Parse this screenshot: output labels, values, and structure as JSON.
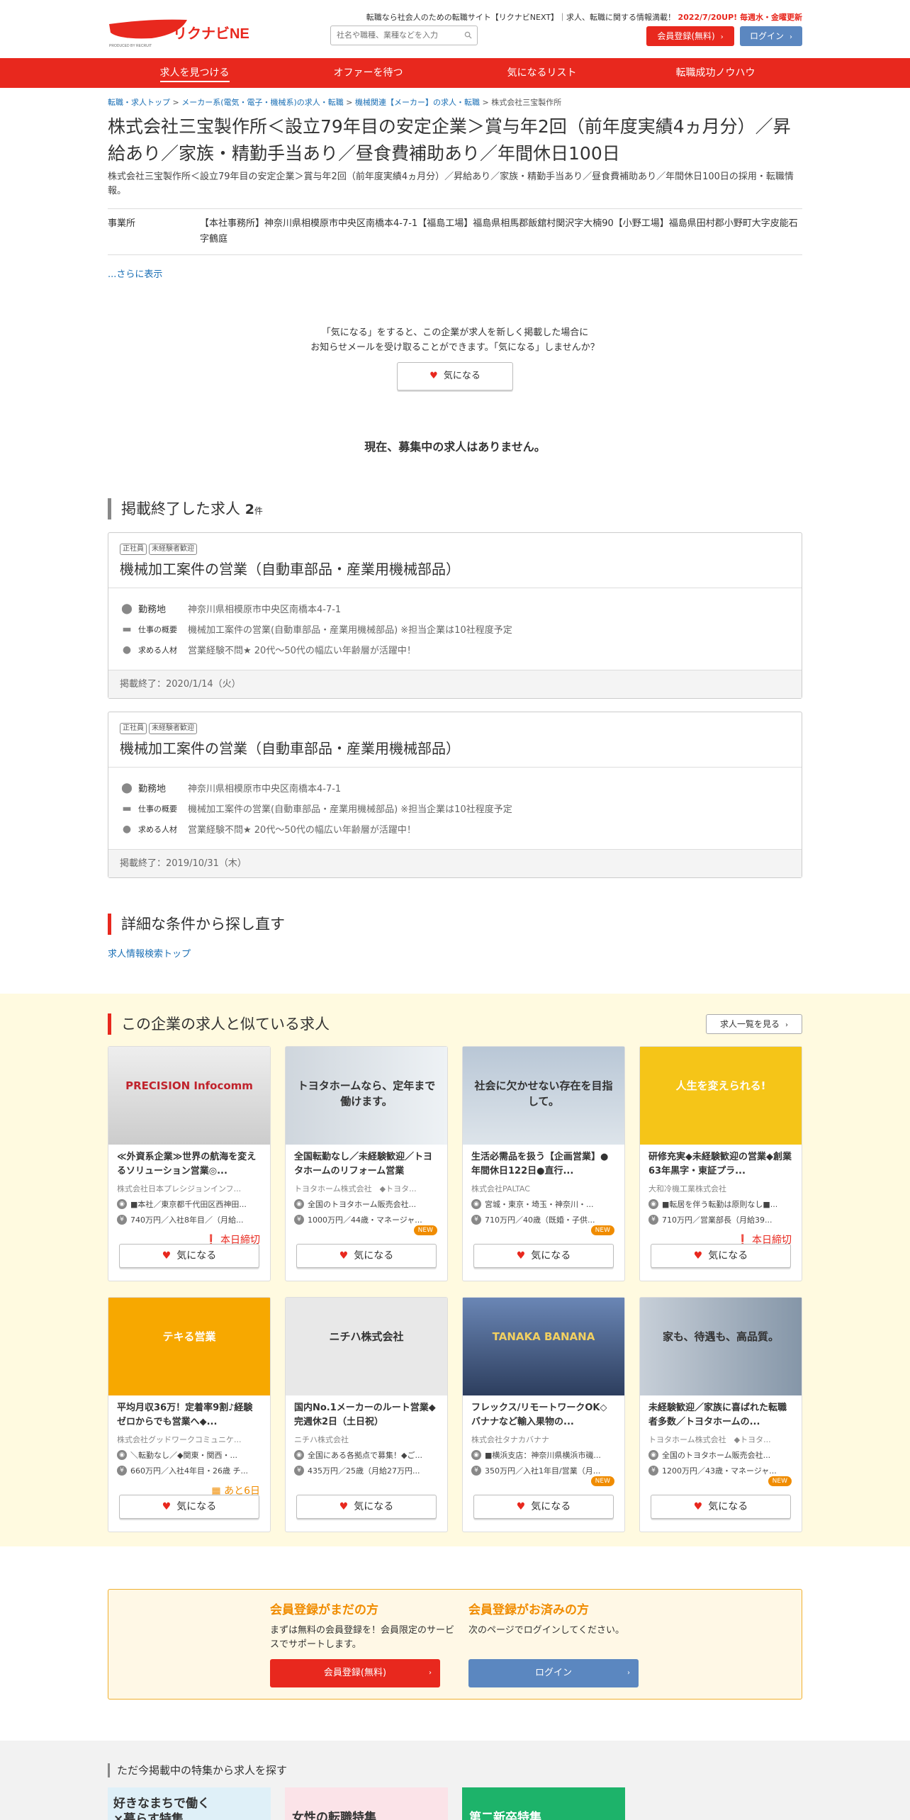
{
  "header": {
    "logo_text": "リクナビNEXT",
    "logo_sub": "PRODUCED BY RECRUIT",
    "tagline": "転職なら社会人のための転職サイト【リクナビNEXT】｜求人、転職に関する情報満載！",
    "tagline_highlight": "2022/7/20UP! 毎週水・金曜更新",
    "search_placeholder": "社名や職種、業種などを入力",
    "register_label": "会員登録(無料)",
    "login_label": "ログイン"
  },
  "nav": [
    {
      "label": "求人を見つける",
      "active": true
    },
    {
      "label": "オファーを待つ",
      "active": false
    },
    {
      "label": "気になるリスト",
      "active": false
    },
    {
      "label": "転職成功ノウハウ",
      "active": false
    }
  ],
  "breadcrumb": {
    "items": [
      "転職・求人トップ",
      "メーカー系(電気・電子・機械系)の求人・転職",
      "機械関連【メーカー】の求人・転職"
    ],
    "current": "株式会社三宝製作所"
  },
  "company": {
    "title": "株式会社三宝製作所＜設立79年目の安定企業＞賞与年2回（前年度実績4ヵ月分）／昇給あり／家族・精勤手当あり／昼食費補助あり／年間休日100日",
    "subtitle": "株式会社三宝製作所＜設立79年目の安定企業＞賞与年2回（前年度実績4ヵ月分）／昇給あり／家族・精勤手当あり／昼食費補助あり／年間休日100日の採用・転職情報。",
    "office_label": "事業所",
    "office_value": "【本社事務所】神奈川県相模原市中央区南橋本4-7-1【福島工場】福島県相馬郡飯舘村関沢字大楠90【小野工場】福島県田村郡小野町大字皮能石字鶴庭",
    "more_label": "...さらに表示"
  },
  "favorite_prompt": {
    "line1": "「気になる」をすると、この企業が求人を新しく掲載した場合に",
    "line2": "お知らせメールを受け取ることができます。「気になる」しませんか？",
    "button": "気になる"
  },
  "no_jobs": "現在、募集中の求人はありません。",
  "ended": {
    "heading": "掲載終了した求人",
    "count": "2",
    "count_unit": "件",
    "jobs": [
      {
        "tags": [
          "正社員",
          "未経験者歓迎"
        ],
        "title": "機械加工案件の営業（自動車部品・産業用機械部品）",
        "location_label": "勤務地",
        "location": "神奈川県相模原市中央区南橋本4-7-1",
        "work_label": "仕事の概要",
        "work": "機械加工案件の営業(自動車部品・産業用機械部品) ※担当企業は10社程度予定",
        "req_label": "求める人材",
        "req": "営業経験不問★ 20代～50代の幅広い年齢層が活躍中！",
        "end_date": "掲載終了：2020/1/14（火）"
      },
      {
        "tags": [
          "正社員",
          "未経験者歓迎"
        ],
        "title": "機械加工案件の営業（自動車部品・産業用機械部品）",
        "location_label": "勤務地",
        "location": "神奈川県相模原市中央区南橋本4-7-1",
        "work_label": "仕事の概要",
        "work": "機械加工案件の営業(自動車部品・産業用機械部品) ※担当企業は10社程度予定",
        "req_label": "求める人材",
        "req": "営業経験不問★ 20代～50代の幅広い年齢層が活躍中！",
        "end_date": "掲載終了：2019/10/31（木）"
      }
    ]
  },
  "search_again": {
    "heading": "詳細な条件から探し直す",
    "link": "求人情報検索トップ"
  },
  "similar": {
    "heading": "この企業の求人と似ている求人",
    "list_button": "求人一覧を見る",
    "fav_label": "気になる",
    "jobs": [
      {
        "title": "≪外資系企業≫世界の航海を変えるソリューション営業◎...",
        "company": "株式会社日本プレシジョンインフ...",
        "loc": "■本社／東京都千代田区西神田...",
        "salary": "740万円／入社8年目／（月給...",
        "badge": "本日締切",
        "badge_type": "red",
        "img_text": "PRECISION Infocomm"
      },
      {
        "title": "全国転勤なし／未経験歓迎／トヨタホームのリフォーム営業",
        "company": "トヨタホーム株式会社　◆トヨタ...",
        "loc": "全国のトヨタホーム販売会社...",
        "salary": "1000万円／44歳・マネージャ...",
        "badge": "NEW",
        "badge_type": "new",
        "img_text": "トヨタホームなら、定年まで働けます。"
      },
      {
        "title": "生活必需品を扱う【企画営業】●年間休日122日●直行...",
        "company": "株式会社PALTAC",
        "loc": "宮城・東京・埼玉・神奈川・...",
        "salary": "710万円／40歳（既婚・子供...",
        "badge": "NEW",
        "badge_type": "new",
        "img_text": "社会に欠かせない存在を目指して。"
      },
      {
        "title": "研修充実◆未経験歓迎の営業◆創業63年黒字・東証プラ...",
        "company": "大和冷機工業株式会社",
        "loc": "■転居を伴う転勤は原則なし■...",
        "salary": "710万円／営業部長（月給39...",
        "badge": "本日締切",
        "badge_type": "red",
        "img_text": "人生を変えられる!"
      },
      {
        "title": "平均月収36万！定着率9割♪経験ゼロからでも営業へ◆...",
        "company": "株式会社グッドワークコミュニケ...",
        "loc": "＼転勤なし／◆関東・関西・...",
        "salary": "660万円／入社4年目・26歳 チ...",
        "badge": "あと6日",
        "badge_type": "orange",
        "img_text": "テキる営業"
      },
      {
        "title": "国内No.1メーカーのルート営業◆完週休2日（土日祝）",
        "company": "ニチハ株式会社",
        "loc": "全国にある各拠点で募集！◆ご...",
        "salary": "435万円／25歳（月給27万円...",
        "badge": "",
        "badge_type": "",
        "img_text": "ニチハ株式会社"
      },
      {
        "title": "フレックス/リモートワークOK◇バナナなど輸入果物の...",
        "company": "株式会社タナカバナナ",
        "loc": "■横浜支店：神奈川県横浜市磯...",
        "salary": "350万円／入社1年目/営業（月...",
        "badge": "NEW",
        "badge_type": "new",
        "img_text": "TANAKA BANANA"
      },
      {
        "title": "未経験歓迎／家族に喜ばれた転職者多数／トヨタホームの...",
        "company": "トヨタホーム株式会社　◆トヨタ...",
        "loc": "全国のトヨタホーム販売会社...",
        "salary": "1200万円／43歳・マネージャ...",
        "badge": "NEW",
        "badge_type": "new",
        "img_text": "家も、待遇も、高品質。"
      }
    ]
  },
  "member": {
    "new_heading": "会員登録がまだの方",
    "new_text": "まずは無料の会員登録を！会員限定のサービスでサポートします。",
    "new_button": "会員登録(無料)",
    "existing_heading": "会員登録がお済みの方",
    "existing_text": "次のページでログインしてください。",
    "existing_button": "ログイン"
  },
  "features": {
    "heading": "ただ今掲載中の特集から求人を探す",
    "banners": [
      "好きなまちで働く×暮らす特集",
      "女性の転職特集",
      "第二新卒特集"
    ]
  },
  "colors": {
    "brand_red": "#e8281e",
    "login_blue": "#5b87c0",
    "accent_orange": "#f08c00"
  }
}
